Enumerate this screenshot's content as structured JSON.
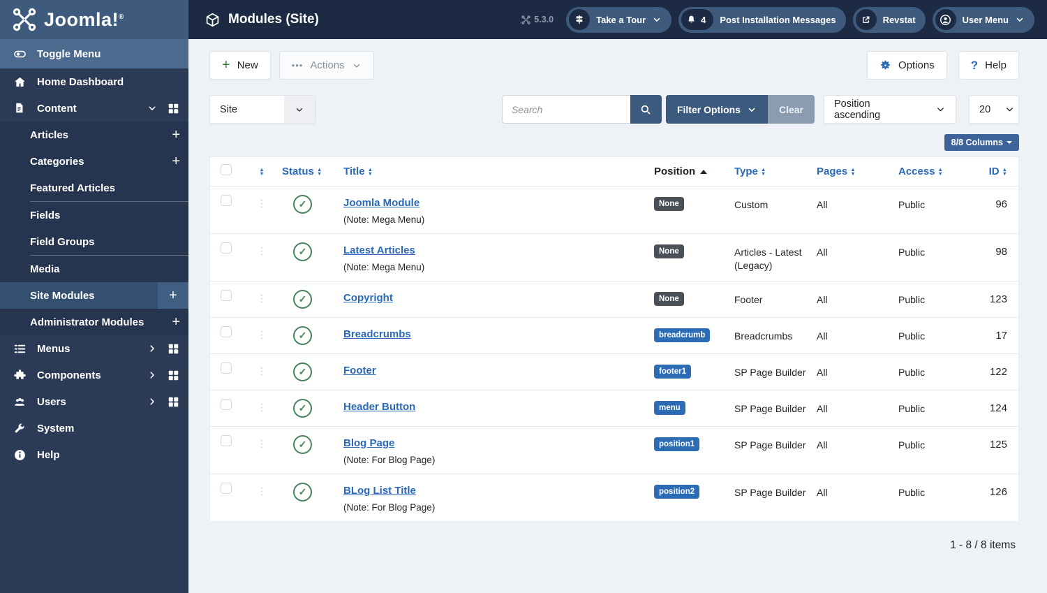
{
  "header": {
    "logo_text": "Joomla!",
    "logo_reg": "®",
    "page_title": "Modules (Site)",
    "version": "5.3.0",
    "tour_label": "Take a Tour",
    "messages_count": "4",
    "messages_label": "Post Installation Messages",
    "revstat_label": "Revstat",
    "user_menu_label": "User Menu"
  },
  "sidebar": {
    "menu": [
      {
        "label": "Toggle Menu"
      },
      {
        "label": "Home Dashboard"
      },
      {
        "label": "Content"
      },
      {
        "label": "Articles"
      },
      {
        "label": "Categories"
      },
      {
        "label": "Featured Articles"
      },
      {
        "label": "Fields"
      },
      {
        "label": "Field Groups"
      },
      {
        "label": "Media"
      },
      {
        "label": "Site Modules"
      },
      {
        "label": "Administrator Modules"
      },
      {
        "label": "Menus"
      },
      {
        "label": "Components"
      },
      {
        "label": "Users"
      },
      {
        "label": "System"
      },
      {
        "label": "Help"
      }
    ]
  },
  "toolbar": {
    "new_label": "New",
    "actions_label": "Actions",
    "options_label": "Options",
    "help_label": "Help"
  },
  "filters": {
    "client_selected": "Site",
    "search_placeholder": "Search",
    "filter_options_label": "Filter Options",
    "clear_label": "Clear",
    "sort_selected": "Position ascending",
    "limit_selected": "20",
    "columns_label": "8/8 Columns"
  },
  "table": {
    "headers": {
      "status": "Status",
      "title": "Title",
      "position": "Position",
      "type": "Type",
      "pages": "Pages",
      "access": "Access",
      "id": "ID"
    },
    "rows": [
      {
        "title": "Joomla Module",
        "note": "(Note: Mega Menu)",
        "position": "None",
        "position_variant": "dark",
        "type": "Custom",
        "pages": "All",
        "access": "Public",
        "id": "96"
      },
      {
        "title": "Latest Articles",
        "note": "(Note: Mega Menu)",
        "position": "None",
        "position_variant": "dark",
        "type": "Articles - Latest (Legacy)",
        "pages": "All",
        "access": "Public",
        "id": "98"
      },
      {
        "title": "Copyright",
        "note": "",
        "position": "None",
        "position_variant": "dark",
        "type": "Footer",
        "pages": "All",
        "access": "Public",
        "id": "123"
      },
      {
        "title": "Breadcrumbs",
        "note": "",
        "position": "breadcrumb",
        "position_variant": "blue",
        "type": "Breadcrumbs",
        "pages": "All",
        "access": "Public",
        "id": "17"
      },
      {
        "title": "Footer",
        "note": "",
        "position": "footer1",
        "position_variant": "blue",
        "type": "SP Page Builder",
        "pages": "All",
        "access": "Public",
        "id": "122"
      },
      {
        "title": "Header Button",
        "note": "",
        "position": "menu",
        "position_variant": "blue",
        "type": "SP Page Builder",
        "pages": "All",
        "access": "Public",
        "id": "124"
      },
      {
        "title": "Blog Page",
        "note": "(Note: For Blog Page)",
        "position": "position1",
        "position_variant": "blue",
        "type": "SP Page Builder",
        "pages": "All",
        "access": "Public",
        "id": "125"
      },
      {
        "title": "BLog List Title",
        "note": "(Note: For Blog Page)",
        "position": "position2",
        "position_variant": "blue",
        "type": "SP Page Builder",
        "pages": "All",
        "access": "Public",
        "id": "126"
      }
    ],
    "footer_count": "1 - 8 / 8 items"
  },
  "colors": {
    "topbar": "#1c2b43",
    "logo_area": "#3e5a7d",
    "sidebar": "#2b3b56",
    "accent_link": "#2a69b8",
    "steel_button": "#3b5a7d",
    "badge_dark": "#495057",
    "badge_blue": "#2c6cb5",
    "success_green": "#45835a",
    "content_bg": "#eef1f6"
  }
}
